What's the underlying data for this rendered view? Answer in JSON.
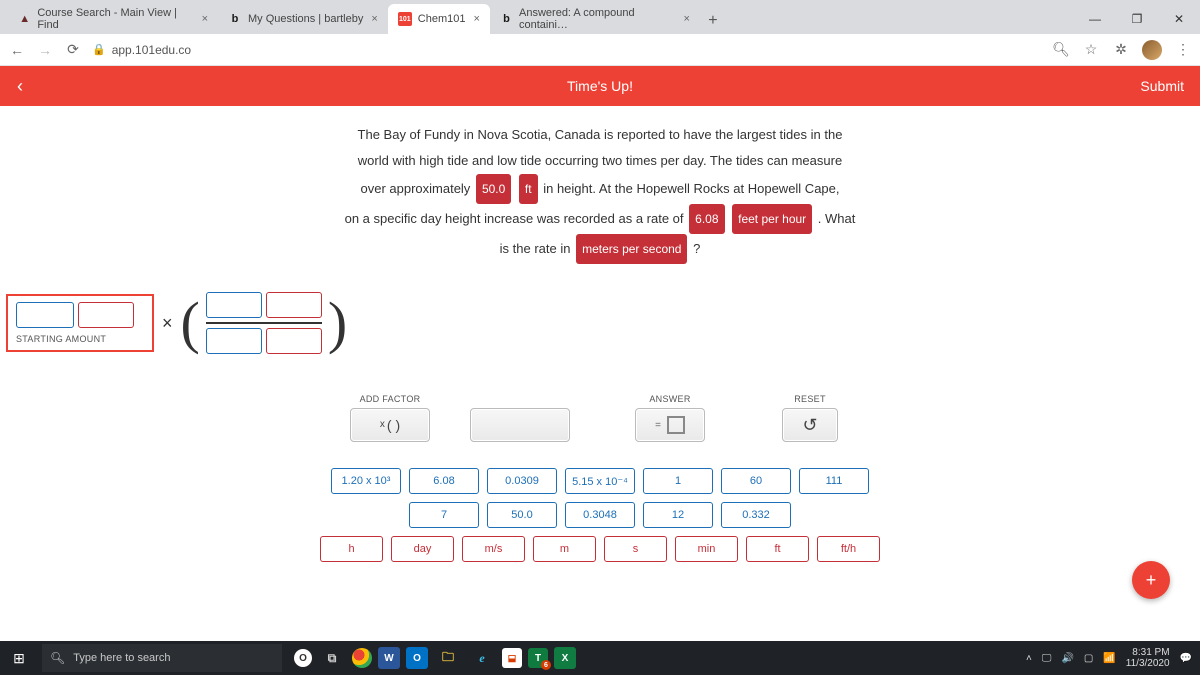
{
  "browser": {
    "tabs": [
      {
        "icon": "▲",
        "label": "Course Search - Main View | Find"
      },
      {
        "icon": "b",
        "label": "My Questions | bartleby"
      },
      {
        "icon": "101",
        "label": "Chem101"
      },
      {
        "icon": "b",
        "label": "Answered: A compound containi…"
      }
    ],
    "url": "app.101edu.co"
  },
  "header": {
    "title": "Time's Up!",
    "submit": "Submit"
  },
  "problem": {
    "l1a": "The Bay of Fundy in Nova Scotia, Canada is reported to have the largest tides in the",
    "l2a": "world with high tide and low tide occurring two times per day. The tides can measure",
    "l3a": "over approximately ",
    "chip1": "50.0",
    "chip2": "ft",
    "l3b": " in height. At the Hopewell Rocks at Hopewell Cape,",
    "l4a": "on a specific day height increase was recorded as a rate of ",
    "chip3": "6.08",
    "chip4": "feet per hour",
    "l4b": " . What",
    "l5a": "is the rate in ",
    "chip5": "meters per second",
    "l5b": " ?"
  },
  "starting_label": "STARTING AMOUNT",
  "controls": {
    "add_factor": "ADD FACTOR",
    "add_factor_btn": "( )",
    "add_factor_x": "x",
    "answer": "ANSWER",
    "eq": "=",
    "reset": "RESET",
    "undo": "↺"
  },
  "keypad": {
    "row1": [
      "1.20 x 10³",
      "6.08",
      "0.0309",
      "5.15 x 10⁻⁴",
      "1",
      "60",
      "111"
    ],
    "row2": [
      "7",
      "50.0",
      "0.3048",
      "12",
      "0.332"
    ],
    "row3": [
      "h",
      "day",
      "m/s",
      "m",
      "s",
      "min",
      "ft",
      "ft/h"
    ]
  },
  "taskbar": {
    "search_placeholder": "Type here to search",
    "clock": {
      "time": "8:31 PM",
      "date": "11/3/2020"
    }
  }
}
